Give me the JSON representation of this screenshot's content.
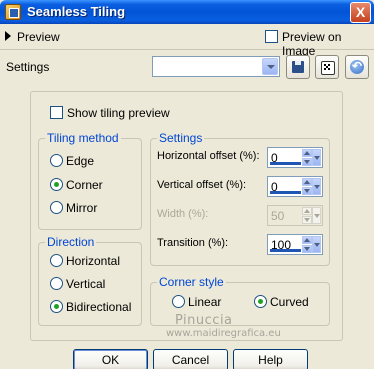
{
  "window": {
    "title": "Seamless Tiling",
    "close_label": "X"
  },
  "preview_bar": {
    "label": "Preview",
    "preview_on_image_label": "Preview on Image",
    "preview_on_image_checked": false
  },
  "settings_bar": {
    "label": "Settings",
    "preset_value": ""
  },
  "show_tiling_preview": {
    "label": "Show tiling preview",
    "checked": false
  },
  "tiling_method": {
    "legend": "Tiling method",
    "options": [
      "Edge",
      "Corner",
      "Mirror"
    ],
    "selected": "Corner"
  },
  "settings": {
    "legend": "Settings",
    "fields": [
      {
        "label": "Horizontal offset (%):",
        "value": "0",
        "enabled": true
      },
      {
        "label": "Vertical offset (%):",
        "value": "0",
        "enabled": true
      },
      {
        "label": "Width (%):",
        "value": "50",
        "enabled": false
      },
      {
        "label": "Transition (%):",
        "value": "100",
        "enabled": true
      }
    ]
  },
  "direction": {
    "legend": "Direction",
    "options": [
      "Horizontal",
      "Vertical",
      "Bidirectional"
    ],
    "selected": "Bidirectional"
  },
  "corner_style": {
    "legend": "Corner style",
    "options": [
      "Linear",
      "Curved"
    ],
    "selected": "Curved"
  },
  "watermark": {
    "name": "Pinuccia",
    "url": "www.maidiregrafica.eu"
  },
  "buttons": {
    "ok": "OK",
    "cancel": "Cancel",
    "help": "Help"
  },
  "colors": {
    "titlebar": "#0254d6",
    "dialog_bg": "#ece9d8",
    "legend_text": "#0046d5",
    "radio_dot": "#21a121"
  }
}
